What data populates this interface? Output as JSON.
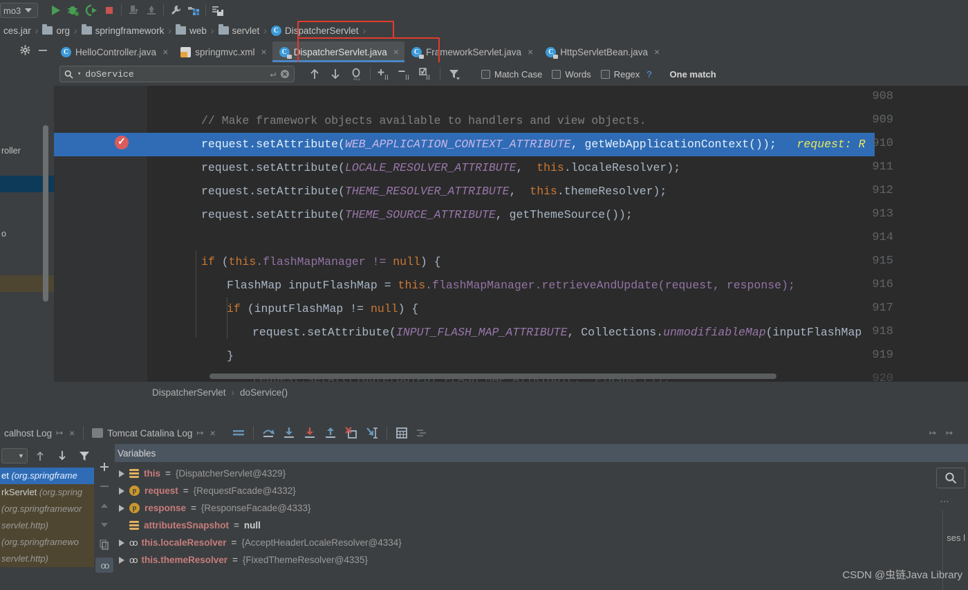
{
  "run_toolbar": {
    "config_name": "mo3",
    "buttons": [
      {
        "name": "run-button",
        "icon": "play-icon",
        "label": "Run"
      },
      {
        "name": "debug-button",
        "icon": "bug-icon",
        "label": "Debug"
      },
      {
        "name": "run-coverage-button",
        "icon": "coverage-icon",
        "label": "Run with Coverage"
      },
      {
        "name": "stop-button",
        "icon": "stop-icon",
        "label": "Stop"
      },
      {
        "name": "deploy-button",
        "icon": "deploy-icon",
        "label": "Deploy"
      },
      {
        "name": "undeploy-button",
        "icon": "undeploy-icon",
        "label": "Undeploy"
      },
      {
        "name": "settings-wrench-button",
        "icon": "wrench-icon",
        "label": "Settings"
      },
      {
        "name": "project-structure-button",
        "icon": "project-structure-icon",
        "label": "Project Structure"
      },
      {
        "name": "save-all-button",
        "icon": "save-all-icon",
        "label": "Save All"
      }
    ]
  },
  "breadcrumb": {
    "items": [
      {
        "label": "ces.jar",
        "icon": "jar-icon"
      },
      {
        "label": "org",
        "icon": "folder-icon"
      },
      {
        "label": "springframework",
        "icon": "folder-icon"
      },
      {
        "label": "web",
        "icon": "folder-icon"
      },
      {
        "label": "servlet",
        "icon": "folder-icon"
      },
      {
        "label": "DispatcherServlet",
        "icon": "class-icon"
      }
    ],
    "separator": "›"
  },
  "left_panel": {
    "gear_icon": "gear-icon",
    "minimize_icon": "minimize-icon",
    "rows": [
      {
        "label": "",
        "state": "normal"
      },
      {
        "label": "",
        "state": "normal"
      },
      {
        "label": "",
        "state": "normal"
      },
      {
        "label": "",
        "state": "normal"
      },
      {
        "label": "",
        "state": "normal"
      },
      {
        "label": "roller",
        "state": "normal"
      },
      {
        "label": "",
        "state": "selected"
      },
      {
        "label": "",
        "state": "normal"
      },
      {
        "label": "",
        "state": "normal"
      },
      {
        "label": "o",
        "state": "normal"
      },
      {
        "label": "",
        "state": "normal"
      },
      {
        "label": "",
        "state": "normal"
      },
      {
        "label": "",
        "state": "warning"
      },
      {
        "label": "",
        "state": "normal"
      }
    ]
  },
  "editor_tabs": {
    "active_index": 2,
    "tabs": [
      {
        "label": "HelloController.java",
        "icon": "java-class-icon",
        "close": "×",
        "active": false
      },
      {
        "label": "springmvc.xml",
        "icon": "xml-file-icon",
        "close": "×",
        "active": false
      },
      {
        "label": "DispatcherServlet.java",
        "icon": "java-class-locked-icon",
        "close": "×",
        "active": true
      },
      {
        "label": "FrameworkServlet.java",
        "icon": "java-class-locked-icon",
        "close": "×",
        "active": false
      },
      {
        "label": "HttpServletBean.java",
        "icon": "java-class-locked-icon",
        "close": "×",
        "active": false
      }
    ],
    "highlight_color": "#e33b2e"
  },
  "find_bar": {
    "search_value": "doService",
    "search_placeholder": "Search",
    "enter_icon": "enter-arrow-icon",
    "clear_icon": "clear-circle-icon",
    "buttons": [
      {
        "name": "find-previous-button",
        "icon": "arrow-up-icon"
      },
      {
        "name": "find-next-button",
        "icon": "arrow-down-icon"
      },
      {
        "name": "select-all-occurrences-button",
        "icon": "select-all-icon"
      },
      {
        "name": "add-selection-button",
        "icon": "add-selection-icon"
      },
      {
        "name": "remove-selection-button",
        "icon": "remove-selection-icon"
      },
      {
        "name": "select-all-button",
        "icon": "select-all-occurrences-icon"
      },
      {
        "name": "filter-button",
        "icon": "filter-icon"
      }
    ],
    "checkboxes": [
      {
        "label": "Match Case",
        "checked": false
      },
      {
        "label": "Words",
        "checked": false
      },
      {
        "label": "Regex",
        "checked": false
      }
    ],
    "help_icon": "question-mark-icon",
    "result_text": "One match"
  },
  "editor": {
    "first_line": 908,
    "highlighted_line": 910,
    "breakpoint_line": 910,
    "breakpoint_icon": "breakpoint-verified-icon",
    "line_numbers": [
      908,
      909,
      910,
      911,
      912,
      913,
      914,
      915,
      916,
      917,
      918,
      919,
      920
    ],
    "lines": {
      "l908": "",
      "l909_comment": "// Make framework objects available to handlers and view objects.",
      "l910_a": "request.setAttribute(",
      "l910_b": "WEB_APPLICATION_CONTEXT_ATTRIBUTE",
      "l910_c": ", getWebApplicationContext());",
      "l910_hint": "request: R",
      "l911_a": "request.setAttribute(",
      "l911_b": "LOCALE_RESOLVER_ATTRIBUTE",
      "l911_c": ",  ",
      "l911_kw": "this",
      "l911_d": ".localeResolver);",
      "l912_a": "request.setAttribute(",
      "l912_b": "THEME_RESOLVER_ATTRIBUTE",
      "l912_c": ",  ",
      "l912_kw": "this",
      "l912_d": ".themeResolver);",
      "l913_a": "request.setAttribute(",
      "l913_b": "THEME_SOURCE_ATTRIBUTE",
      "l913_c": ", getThemeSource());",
      "l914": "",
      "l915_kw": "if",
      "l915_a": " (",
      "l915_kw2": "this",
      "l915_b": ".flashMapManager != ",
      "l915_kw3": "null",
      "l915_c": ") {",
      "l916_a": "FlashMap inputFlashMap = ",
      "l916_kw": "this",
      "l916_b": ".flashMapManager.retrieveAndUpdate(request, response);",
      "l917_kw": "if",
      "l917_a": " (inputFlashMap != ",
      "l917_kw2": "null",
      "l917_b": ") {",
      "l918_a": "request.setAttribute(",
      "l918_b": "INPUT_FLASH_MAP_ATTRIBUTE",
      "l918_c": ", Collections.",
      "l918_d": "unmodifiableMap",
      "l918_e": "(inputFlashMap",
      "l919": "}",
      "l920_partial": "request.setAttribute(OUTPUT_FLASH_MAP_ATTRIBUTE,  FlashM ());"
    }
  },
  "editor_breadcrumb": {
    "class": "DispatcherServlet",
    "separator": "›",
    "method": "doService()"
  },
  "debug_tabs": {
    "tabs": [
      {
        "label": "calhost Log",
        "icon": "log-icon",
        "pin": "↦",
        "close": "×"
      },
      {
        "label": "Tomcat Catalina Log",
        "icon": "tomcat-log-icon",
        "pin": "↦",
        "close": "×"
      }
    ],
    "buttons": [
      {
        "name": "show-execution-point-button",
        "icon": "execution-point-icon"
      },
      {
        "name": "step-over-button",
        "icon": "step-over-icon"
      },
      {
        "name": "step-into-button",
        "icon": "step-into-icon"
      },
      {
        "name": "force-step-into-button",
        "icon": "force-step-into-icon"
      },
      {
        "name": "step-out-button",
        "icon": "step-out-icon"
      },
      {
        "name": "drop-frame-button",
        "icon": "drop-frame-icon"
      },
      {
        "name": "run-to-cursor-button",
        "icon": "run-to-cursor-icon"
      },
      {
        "name": "evaluate-expression-button",
        "icon": "calculator-icon"
      },
      {
        "name": "mute-breakpoints-button",
        "icon": "mute-breakpoints-icon"
      }
    ],
    "right_pins": [
      "↦",
      "↦"
    ]
  },
  "frames": {
    "thread_selector_icon": "chevron-down-icon",
    "toolbar_buttons": [
      {
        "name": "frames-up-button",
        "icon": "arrow-up-icon"
      },
      {
        "name": "frames-down-button",
        "icon": "arrow-down-icon"
      },
      {
        "name": "frames-filter-button",
        "icon": "filter-icon"
      }
    ],
    "rows": [
      {
        "method": "et ",
        "pkg": "(org.springframe",
        "state": "selected"
      },
      {
        "method": "rkServlet ",
        "pkg": "(org.spring",
        "state": "library"
      },
      {
        "method": "",
        "pkg": "(org.springframewor",
        "state": "library"
      },
      {
        "method": "",
        "pkg": "servlet.http)",
        "state": "library"
      },
      {
        "method": "",
        "pkg": "(org.springframewo",
        "state": "library"
      },
      {
        "method": "",
        "pkg": "servlet.http)",
        "state": "library"
      }
    ]
  },
  "vars_side_buttons": [
    {
      "name": "add-watch-button",
      "icon": "plus-icon"
    },
    {
      "name": "remove-watch-button",
      "icon": "minus-icon"
    },
    {
      "name": "move-up-button",
      "icon": "triangle-up-icon"
    },
    {
      "name": "move-down-button",
      "icon": "triangle-down-icon"
    },
    {
      "name": "copy-value-button",
      "icon": "copy-icon"
    },
    {
      "name": "watches-toggle-button",
      "icon": "watches-icon"
    }
  ],
  "variables": {
    "header_label": "Variables",
    "header_icon": "variables-icon",
    "rows": [
      {
        "expandable": true,
        "icon": "stack-frame-icon",
        "name": "this",
        "eq": " = ",
        "value": "{DispatcherServlet@4329}",
        "value_style": "ref"
      },
      {
        "expandable": true,
        "icon": "parameter-icon",
        "name": "request",
        "eq": " = ",
        "value": "{RequestFacade@4332}",
        "value_style": "ref"
      },
      {
        "expandable": true,
        "icon": "parameter-icon",
        "name": "response",
        "eq": " = ",
        "value": "{ResponseFacade@4333}",
        "value_style": "ref"
      },
      {
        "expandable": false,
        "icon": "stack-frame-icon",
        "name": "attributesSnapshot",
        "eq": " = ",
        "value": "null",
        "value_style": "null"
      },
      {
        "expandable": true,
        "icon": "field-icon",
        "name": "this.localeResolver",
        "eq": " = ",
        "value": "{AcceptHeaderLocaleResolver@4334}",
        "value_style": "ref"
      },
      {
        "expandable": true,
        "icon": "field-icon",
        "name": "this.themeResolver",
        "eq": " = ",
        "value": "{FixedThemeResolver@4335}",
        "value_style": "ref"
      }
    ]
  },
  "right_side": {
    "search_icon": "search-icon",
    "dots_label": "…",
    "partial_text": "ses l"
  },
  "watermark": "CSDN @虫链Java Library",
  "colors": {
    "accent_blue": "#4a88c7",
    "highlight_red": "#e33b2e",
    "selection_blue": "#2f6cb5",
    "editor_bg": "#2b2b2b",
    "panel_bg": "#3c3f41",
    "gutter_bg": "#313335"
  }
}
